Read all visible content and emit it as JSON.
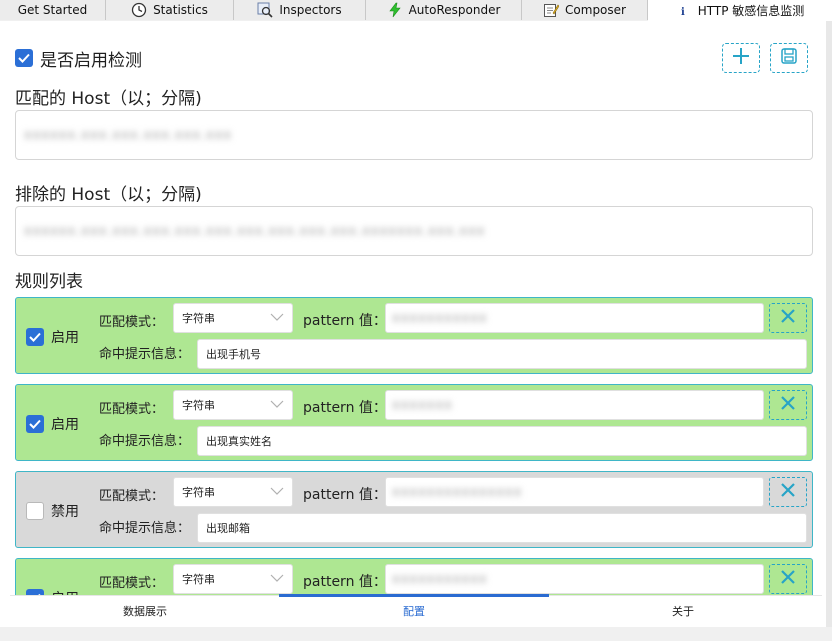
{
  "top_tabs": [
    {
      "label": "Get Started",
      "icon": "none"
    },
    {
      "label": "Statistics",
      "icon": "clock-icon"
    },
    {
      "label": "Inspectors",
      "icon": "inspector-icon"
    },
    {
      "label": "AutoResponder",
      "icon": "lightning-icon"
    },
    {
      "label": "Composer",
      "icon": "composer-icon"
    },
    {
      "label": "HTTP 敏感信息监测",
      "icon": "info-icon",
      "active": true
    }
  ],
  "settings": {
    "enable_label": "是否启用检测",
    "enabled": true,
    "match_host_title": "匹配的 Host（以；分隔)",
    "match_host_value": "xxxxxx.xxx.xxx.xxx.xxx.xxx",
    "exclude_host_title": "排除的 Host（以；分隔)",
    "exclude_host_value": "xxxxxx.xxx.xxx.xxx.xxx.xxx.xxx.xxx.xxx.xxx.xxxxxxx.xxx.xxx",
    "rules_title": "规则列表"
  },
  "rule_labels": {
    "mode_label": "匹配模式：",
    "pattern_label": "pattern 值：",
    "hint_label": "命中提示信息："
  },
  "rules": [
    {
      "enabled": true,
      "toggle_label": "启用",
      "mode": "字符串",
      "pattern": "xxxxxxxxxxx",
      "hint": "出现手机号"
    },
    {
      "enabled": true,
      "toggle_label": "启用",
      "mode": "字符串",
      "pattern": "xxxxxxx",
      "hint": "出现真实姓名"
    },
    {
      "enabled": false,
      "toggle_label": "禁用",
      "mode": "字符串",
      "pattern": "xxxxxxxxxxxxxxx",
      "hint": "出现邮箱"
    },
    {
      "enabled": true,
      "toggle_label": "启用",
      "mode": "字符串",
      "pattern": "xxxxxxxxxxx",
      "hint": ""
    }
  ],
  "bottom_tabs": [
    {
      "label": "数据展示"
    },
    {
      "label": "配置",
      "active": true
    },
    {
      "label": "关于"
    }
  ],
  "colors": {
    "accent": "#2b6fd6",
    "rule_enabled_bg": "#aee792",
    "rule_disabled_bg": "#d9d9d9",
    "dashed_border": "#27a4c7"
  }
}
